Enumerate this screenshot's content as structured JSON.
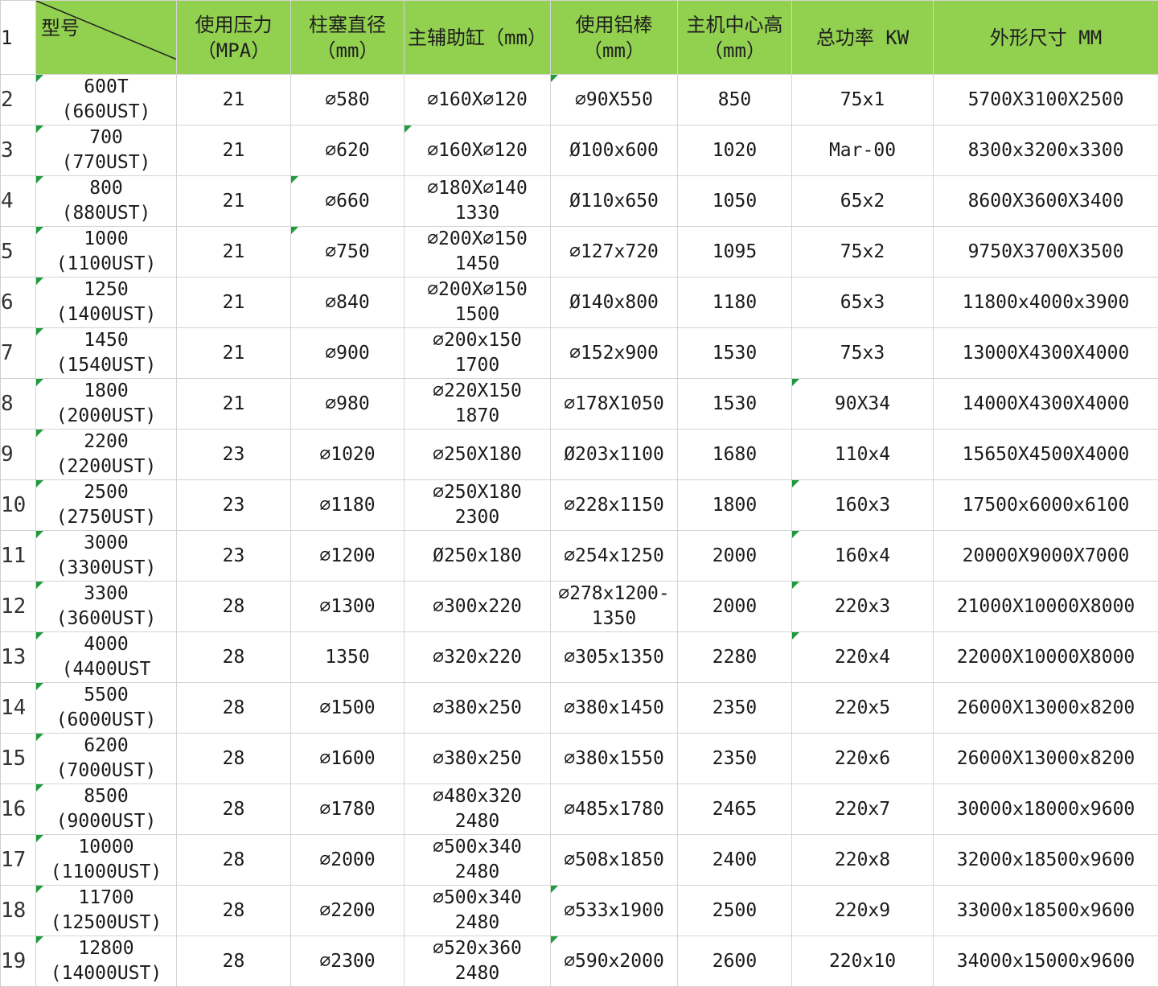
{
  "app": {
    "accent_color": "#92d050",
    "flag_color": "#1f9a3c"
  },
  "header": {
    "row_number": "1",
    "cells": [
      "型号",
      "使用压力\n（MPA）",
      "柱塞直径\n（mm）",
      "主辅助缸（mm）",
      "使用铝棒\n（mm）",
      "主机中心高\n（mm）",
      "总功率 KW",
      "外形尺寸       MM"
    ]
  },
  "rows": [
    {
      "n": "2",
      "cells": [
        "600T\n(660UST)",
        "21",
        "⌀580",
        "⌀160X⌀120",
        "⌀90X550",
        "850",
        "75x1",
        "5700X3100X2500"
      ]
    },
    {
      "n": "3",
      "cells": [
        "700\n(770UST)",
        "21",
        "⌀620",
        "⌀160X⌀120",
        "Ø100x600",
        "1020",
        "Mar-00",
        "8300x3200x3300"
      ]
    },
    {
      "n": "4",
      "cells": [
        "800\n(880UST)",
        "21",
        "⌀660",
        "⌀180X⌀140\n1330",
        "Ø110x650",
        "1050",
        "65x2",
        "8600X3600X3400"
      ]
    },
    {
      "n": "5",
      "cells": [
        "1000\n(1100UST)",
        "21",
        "⌀750",
        "⌀200X⌀150\n1450",
        "⌀127x720",
        "1095",
        "75x2",
        "9750X3700X3500"
      ]
    },
    {
      "n": "6",
      "cells": [
        "1250\n(1400UST)",
        "21",
        "⌀840",
        "⌀200X⌀150\n1500",
        "Ø140x800",
        "1180",
        "65x3",
        "11800x4000x3900"
      ]
    },
    {
      "n": "7",
      "cells": [
        "1450\n(1540UST)",
        "21",
        "⌀900",
        "⌀200x150\n1700",
        "⌀152x900",
        "1530",
        "75x3",
        "13000X4300X4000"
      ]
    },
    {
      "n": "8",
      "cells": [
        "1800\n(2000UST)",
        "21",
        "⌀980",
        "⌀220X150\n1870",
        "⌀178X1050",
        "1530",
        "90X34",
        "14000X4300X4000"
      ]
    },
    {
      "n": "9",
      "cells": [
        "2200\n(2200UST)",
        "23",
        "⌀1020",
        "⌀250X180",
        "Ø203x1100",
        "1680",
        "110x4",
        "15650X4500X4000"
      ]
    },
    {
      "n": "10",
      "cells": [
        "2500\n(2750UST)",
        "23",
        "⌀1180",
        "⌀250X180\n2300",
        "⌀228x1150",
        "1800",
        "160x3",
        "17500x6000x6100"
      ]
    },
    {
      "n": "11",
      "cells": [
        "3000\n(3300UST)",
        "23",
        "⌀1200",
        "Ø250x180",
        "⌀254x1250",
        "2000",
        "160x4",
        "20000X9000X7000"
      ]
    },
    {
      "n": "12",
      "cells": [
        "3300\n(3600UST)",
        "28",
        "⌀1300",
        "⌀300x220",
        "⌀278x1200-\n1350",
        "2000",
        "220x3",
        "21000X10000X8000"
      ]
    },
    {
      "n": "13",
      "cells": [
        "4000\n(4400UST",
        "28",
        "1350",
        "⌀320x220",
        "⌀305x1350",
        "2280",
        "220x4",
        "22000X10000X8000"
      ]
    },
    {
      "n": "14",
      "cells": [
        "5500\n(6000UST)",
        "28",
        "⌀1500",
        "⌀380x250",
        "⌀380x1450",
        "2350",
        "220x5",
        "26000X13000x8200"
      ]
    },
    {
      "n": "15",
      "cells": [
        "6200\n(7000UST)",
        "28",
        "⌀1600",
        "⌀380x250",
        "⌀380x1550",
        "2350",
        "220x6",
        "26000X13000x8200"
      ]
    },
    {
      "n": "16",
      "cells": [
        "8500\n(9000UST)",
        "28",
        "⌀1780",
        "⌀480x320\n2480",
        "⌀485x1780",
        "2465",
        "220x7",
        "30000x18000x9600"
      ]
    },
    {
      "n": "17",
      "cells": [
        "10000\n(11000UST)",
        "28",
        "⌀2000",
        "⌀500x340\n2480",
        "⌀508x1850",
        "2400",
        "220x8",
        "32000x18500x9600"
      ]
    },
    {
      "n": "18",
      "cells": [
        "11700\n(12500UST)",
        "28",
        "⌀2200",
        "⌀500x340\n2480",
        "⌀533x1900",
        "2500",
        "220x9",
        "33000x18500x9600"
      ]
    },
    {
      "n": "19",
      "cells": [
        "12800\n(14000UST)",
        "28",
        "⌀2300",
        "⌀520x360\n2480",
        "⌀590x2000",
        "2600",
        "220x10",
        "34000x15000x9600"
      ]
    }
  ]
}
